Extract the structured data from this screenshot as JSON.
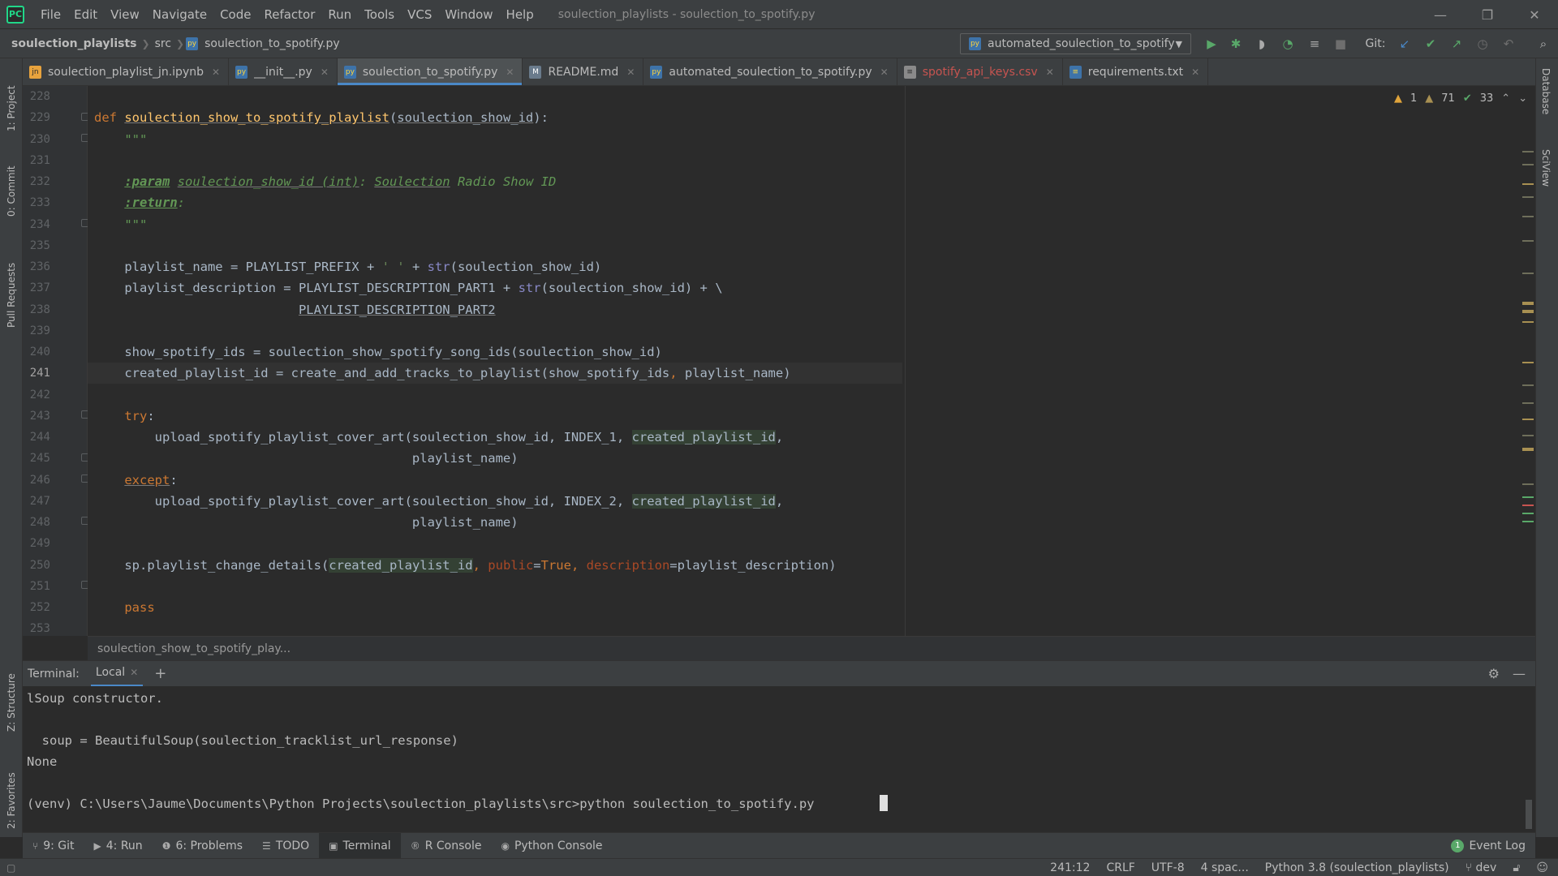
{
  "menu": {
    "items": [
      "File",
      "Edit",
      "View",
      "Navigate",
      "Code",
      "Refactor",
      "Run",
      "Tools",
      "VCS",
      "Window",
      "Help"
    ],
    "window_title": "soulection_playlists - soulection_to_spotify.py"
  },
  "nav": {
    "project": "soulection_playlists",
    "folder": "src",
    "file": "soulection_to_spotify.py",
    "run_config": "automated_soulection_to_spotify",
    "git_label": "Git:"
  },
  "tabs": [
    {
      "label": "soulection_playlist_jn.ipynb",
      "icon": "notebook-icon"
    },
    {
      "label": "__init__.py",
      "icon": "python-file-icon"
    },
    {
      "label": "soulection_to_spotify.py",
      "icon": "python-file-icon"
    },
    {
      "label": "README.md",
      "icon": "markdown-file-icon"
    },
    {
      "label": "automated_soulection_to_spotify.py",
      "icon": "python-file-icon"
    },
    {
      "label": "spotify_api_keys.csv",
      "icon": "csv-file-icon"
    },
    {
      "label": "requirements.txt",
      "icon": "text-file-icon"
    }
  ],
  "left_tools": [
    "1: Project",
    "0: Commit",
    "Pull Requests",
    "Z: Structure",
    "2: Favorites"
  ],
  "right_tools": [
    "Database",
    "SciView"
  ],
  "inspections": {
    "warnings": "1",
    "weak_warnings": "71",
    "ok": "33"
  },
  "line_numbers": [
    "228",
    "229",
    "230",
    "231",
    "232",
    "233",
    "234",
    "235",
    "236",
    "237",
    "238",
    "239",
    "240",
    "241",
    "242",
    "243",
    "244",
    "245",
    "246",
    "247",
    "248",
    "249",
    "250",
    "251",
    "252",
    "253"
  ],
  "current_line": "241",
  "code": {
    "l229_def": "def ",
    "l229_fn": "soulection_show_to_spotify_playlist",
    "l229_open": "(",
    "l229_param": "soulection_show_id",
    "l229_close": "):",
    "l230": "    \"\"\"",
    "l232_indent": "    ",
    "l232_tag": ":param",
    "l232_sp": " ",
    "l232_name": "soulection_show_id (int)",
    "l232_colon": ": ",
    "l232_word": "Soulection",
    "l232_rest": " Radio Show ID",
    "l233_indent": "    ",
    "l233_tag": ":return",
    "l233_colon": ":",
    "l234": "    \"\"\"",
    "l236_a": "    playlist_name = PLAYLIST_PREFIX + ",
    "l236_str": "' '",
    "l236_b": " + ",
    "l236_bi": "str",
    "l236_c": "(soulection_show_id)",
    "l237_a": "    playlist_description = PLAYLIST_DESCRIPTION_PART1 + ",
    "l237_bi": "str",
    "l237_c": "(soulection_show_id) + \\",
    "l238_indent": "                           ",
    "l238_name": "PLAYLIST_DESCRIPTION_PART2",
    "l240": "    show_spotify_ids = soulection_show_spotify_song_ids(soulection_show_id)",
    "l241_a": "    created_playlist_id = create_and_add_tracks_to_playlist(show_spotify_ids",
    "l241_comma": ",",
    "l241_b": " playlist_name)",
    "l243_indent": "    ",
    "l243_kw": "try",
    "l243_colon": ":",
    "l244_a": "        upload_spotify_playlist_cover_art(soulection_show_id, INDEX_1, ",
    "l244_hl": "created_playlist_id",
    "l244_b": ",",
    "l245": "                                          playlist_name)",
    "l246_indent": "    ",
    "l246_kw": "except",
    "l246_colon": ":",
    "l247_a": "        upload_spotify_playlist_cover_art(soulection_show_id, INDEX_2, ",
    "l247_hl": "created_playlist_id",
    "l247_b": ",",
    "l248": "                                          playlist_name)",
    "l250_a": "    sp.playlist_change_details(",
    "l250_hl": "created_playlist_id",
    "l250_comma1": ", ",
    "l250_kw1": "public",
    "l250_eq1": "=",
    "l250_true": "True",
    "l250_comma2": ", ",
    "l250_kw2": "description",
    "l250_eq2": "=playlist_description)",
    "l252_indent": "    ",
    "l252_kw": "pass"
  },
  "breadcrumb": "soulection_show_to_spotify_play...",
  "terminal": {
    "label": "Terminal:",
    "tab": "Local",
    "lines": [
      "lSoup constructor.",
      "",
      "  soup = BeautifulSoup(soulection_tracklist_url_response)",
      "None",
      "",
      "(venv) C:\\Users\\Jaume\\Documents\\Python Projects\\soulection_playlists\\src>python soulection_to_spotify.py "
    ]
  },
  "bottom_tools": [
    {
      "label": "9: Git",
      "icon": "git-branch-icon"
    },
    {
      "label": "4: Run",
      "icon": "run-icon"
    },
    {
      "label": "6: Problems",
      "icon": "problems-icon"
    },
    {
      "label": "TODO",
      "icon": "todo-icon"
    },
    {
      "label": "Terminal",
      "icon": "terminal-icon"
    },
    {
      "label": "R Console",
      "icon": "r-console-icon"
    },
    {
      "label": "Python Console",
      "icon": "python-console-icon"
    }
  ],
  "event_log": {
    "count": "1",
    "label": "Event Log"
  },
  "status": {
    "position": "241:12",
    "line_sep": "CRLF",
    "encoding": "UTF-8",
    "indent": "4 spac...",
    "interpreter": "Python 3.8 (soulection_playlists)",
    "branch": "dev"
  }
}
